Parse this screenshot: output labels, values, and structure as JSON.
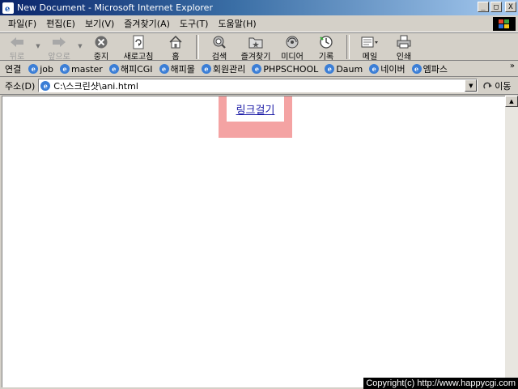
{
  "window": {
    "title": "New Document - Microsoft Internet Explorer",
    "buttons": {
      "minimize": "_",
      "maximize": "□",
      "close": "X"
    }
  },
  "menu": {
    "items": [
      {
        "label": "파일(F)"
      },
      {
        "label": "편집(E)"
      },
      {
        "label": "보기(V)"
      },
      {
        "label": "즐겨찾기(A)"
      },
      {
        "label": "도구(T)"
      },
      {
        "label": "도움말(H)"
      }
    ]
  },
  "toolbar": {
    "back": "뒤로",
    "forward": "앞으로",
    "stop": "중지",
    "refresh": "새로고침",
    "home": "홈",
    "search": "검색",
    "favorites": "즐겨찾기",
    "media": "미디어",
    "history": "기록",
    "mail": "메일",
    "print": "인쇄"
  },
  "links": {
    "label": "연결",
    "items": [
      {
        "label": "job"
      },
      {
        "label": "master"
      },
      {
        "label": "해피CGI"
      },
      {
        "label": "해피몰"
      },
      {
        "label": "회원관리"
      },
      {
        "label": "PHPSCHOOL"
      },
      {
        "label": "Daum"
      },
      {
        "label": "네이버"
      },
      {
        "label": "엠파스"
      }
    ],
    "more": "»"
  },
  "address": {
    "label": "주소(D)",
    "value": "C:\\스크린샷\\ani.html",
    "go_label": "이동"
  },
  "content": {
    "link_text": "링크걸기",
    "link_box_color": "#f4a3a3"
  },
  "footer": {
    "copyright": "Copyright(c) http://www.happycgi.com"
  }
}
